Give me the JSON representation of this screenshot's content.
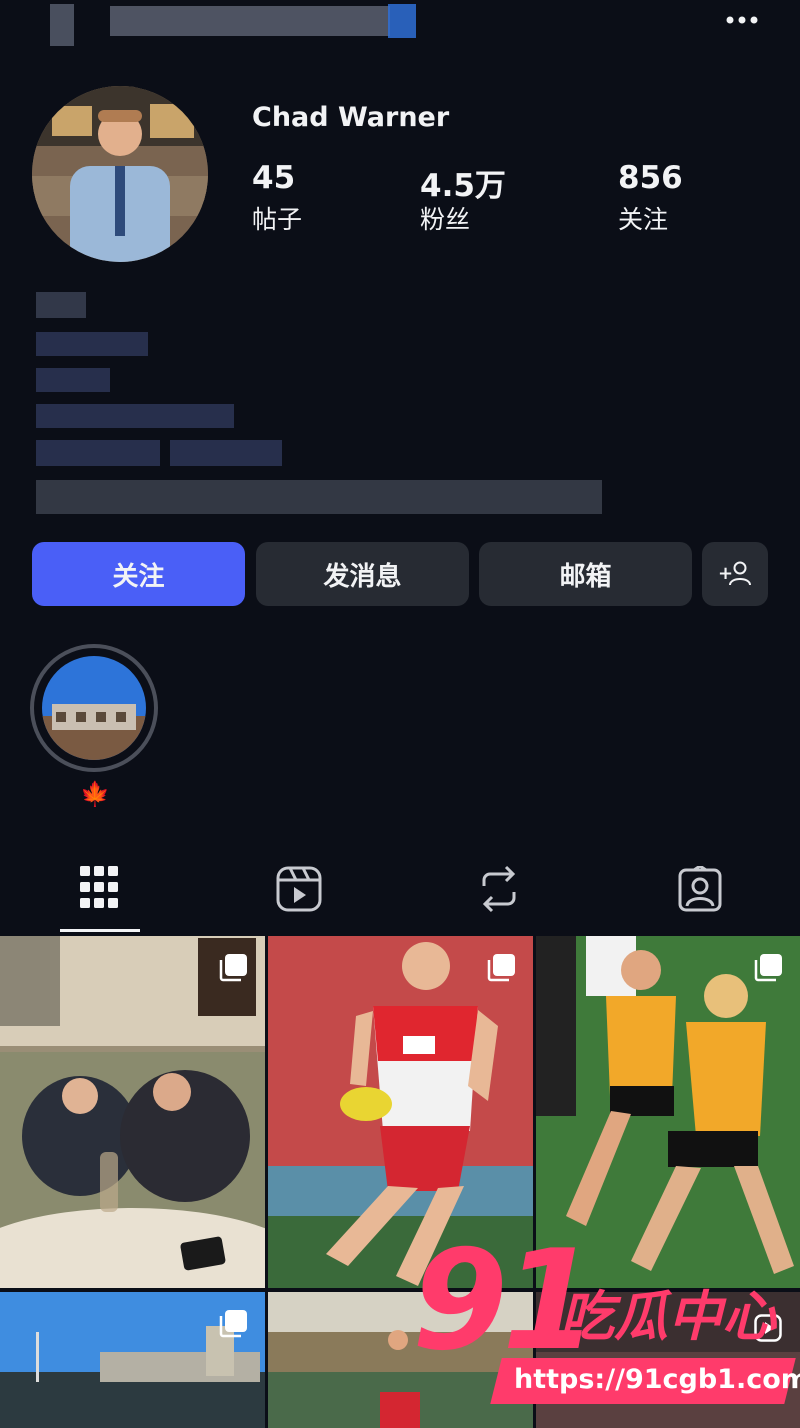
{
  "header": {
    "more_icon": "more-dots-icon"
  },
  "profile": {
    "name": "Chad Warner",
    "stats": [
      {
        "value": "45",
        "label": "帖子"
      },
      {
        "value": "4.5万",
        "label": "粉丝"
      },
      {
        "value": "856",
        "label": "关注"
      }
    ]
  },
  "actions": {
    "follow": "关注",
    "message": "发消息",
    "email": "邮箱",
    "add_user_icon": "add-user-icon"
  },
  "highlights": [
    {
      "label": "🍁"
    }
  ],
  "tabs": [
    {
      "icon": "grid-icon",
      "active": true
    },
    {
      "icon": "reels-icon",
      "active": false
    },
    {
      "icon": "repost-icon",
      "active": false
    },
    {
      "icon": "tagged-icon",
      "active": false
    }
  ],
  "watermark": {
    "number": "91",
    "title": "吃瓜中心",
    "url": "https://91cgb1.com"
  },
  "colors": {
    "background": "#0b0e17",
    "primary_button": "#4a5ff7",
    "secondary_button": "#272b33",
    "watermark_pink": "#ff3b6b"
  }
}
